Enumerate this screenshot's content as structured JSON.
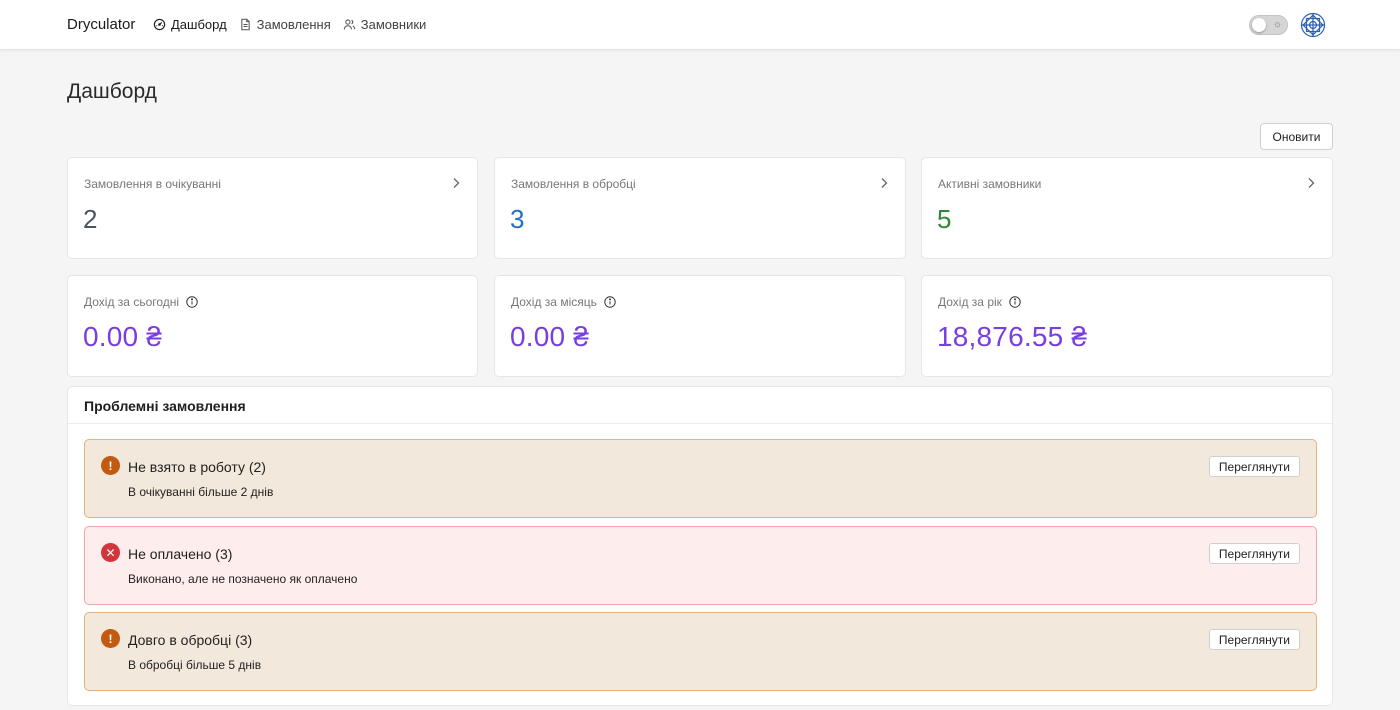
{
  "header": {
    "brand": "Dryculator",
    "nav": [
      {
        "label": "Дашборд",
        "icon": "dashboard-icon",
        "active": true
      },
      {
        "label": "Замовлення",
        "icon": "document-icon",
        "active": false
      },
      {
        "label": "Замовники",
        "icon": "users-icon",
        "active": false
      }
    ],
    "theme_toggle_icon": "sun-icon",
    "avatar_icon": "globe-avatar-icon"
  },
  "page": {
    "title": "Дашборд",
    "refresh_label": "Оновити"
  },
  "stats": [
    {
      "label": "Замовлення в очікуванні",
      "value": "2",
      "color": "#4a5560"
    },
    {
      "label": "Замовлення в обробці",
      "value": "3",
      "color": "#1f6fc4"
    },
    {
      "label": "Активні замовники",
      "value": "5",
      "color": "#2f8a3c"
    }
  ],
  "income": [
    {
      "label": "Дохід за сьогодні",
      "value": "0.00 ₴"
    },
    {
      "label": "Дохід за місяць",
      "value": "0.00 ₴"
    },
    {
      "label": "Дохід за рік",
      "value": "18,876.55 ₴"
    }
  ],
  "problems": {
    "title": "Проблемні замовлення",
    "items": [
      {
        "title": "Не взято в роботу (2)",
        "desc": "В очікуванні більше 2 днів",
        "button": "Переглянути",
        "severity": "warning",
        "icon": "exclamation-icon"
      },
      {
        "title": "Не оплачено (3)",
        "desc": "Виконано, але не позначено як оплачено",
        "button": "Переглянути",
        "severity": "error",
        "icon": "x-circle-icon"
      },
      {
        "title": "Довго в обробці (3)",
        "desc": "В обробці більше 5 днів",
        "button": "Переглянути",
        "severity": "warning",
        "icon": "exclamation-icon"
      }
    ]
  },
  "colors": {
    "money": "#7a3ee0",
    "warning_bg": "#f3e8dc",
    "error_bg": "#fdeeed"
  }
}
